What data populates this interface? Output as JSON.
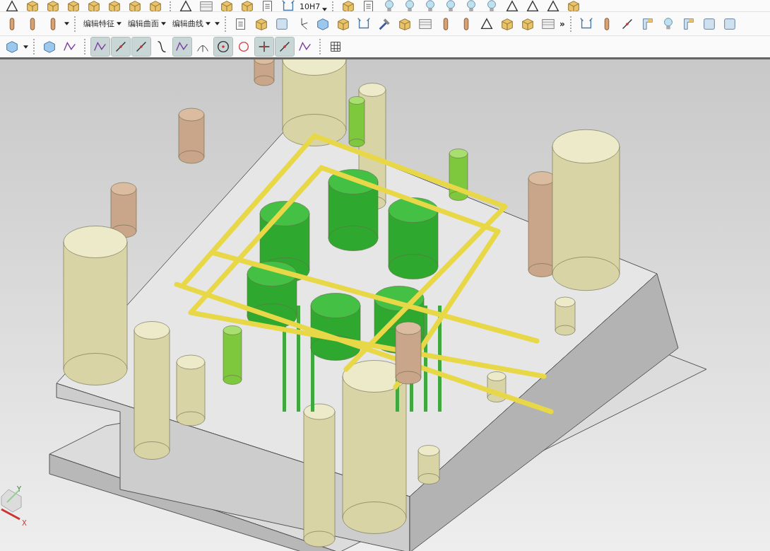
{
  "toolbar_top": {
    "reading": "10H7"
  },
  "menus": [
    {
      "label": "编辑特征"
    },
    {
      "label": "编辑曲面"
    },
    {
      "label": "编辑曲线"
    }
  ],
  "overflow": "»",
  "snap_tools": [
    {
      "on": true
    },
    {
      "on": true
    },
    {
      "on": true
    },
    {
      "on": false
    },
    {
      "on": true
    },
    {
      "on": false
    },
    {
      "on": true
    },
    {
      "on": false
    },
    {
      "on": true
    },
    {
      "on": true
    },
    {
      "on": false
    }
  ],
  "triad": {
    "y_label": "Y",
    "x_label": "X"
  }
}
